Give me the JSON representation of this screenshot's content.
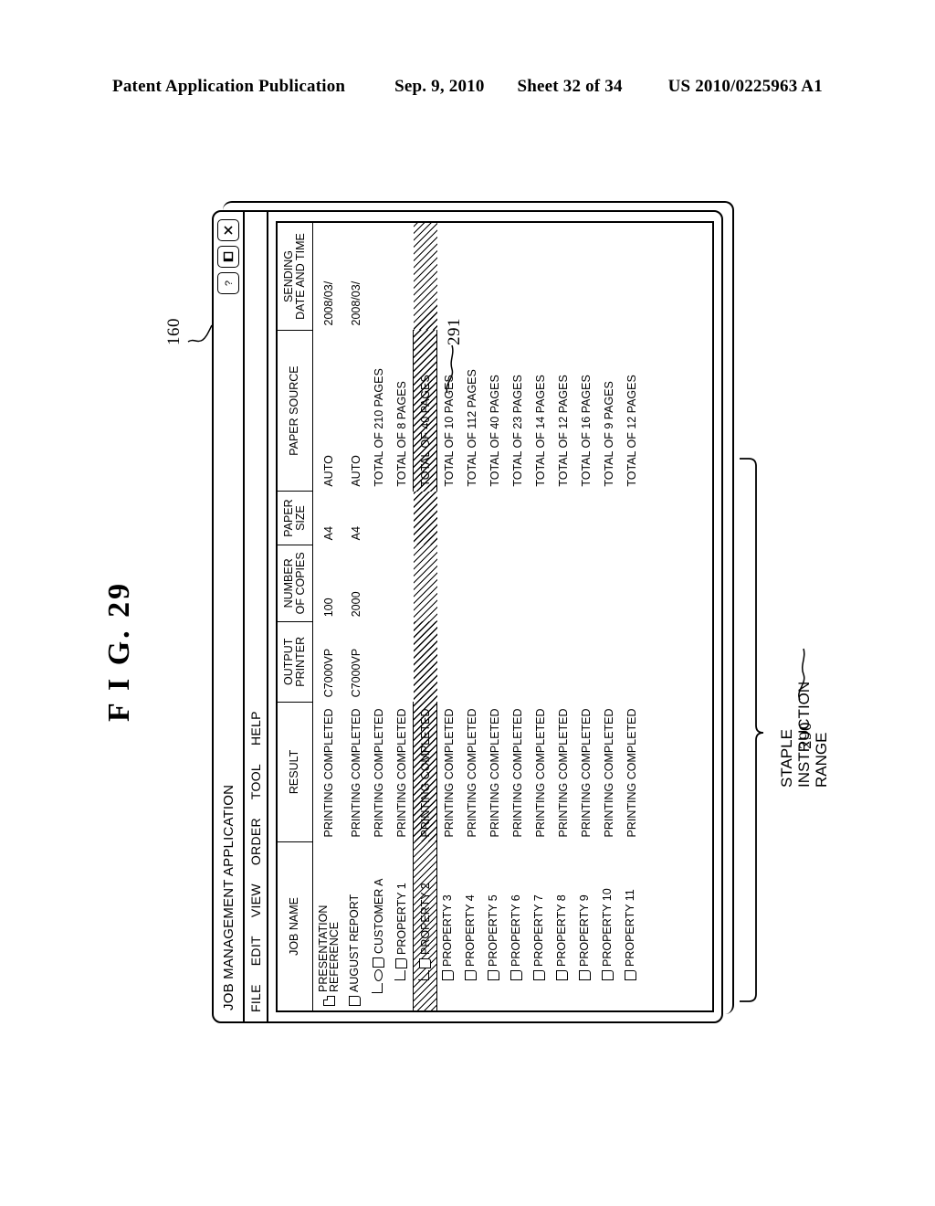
{
  "patent_header": {
    "publication": "Patent Application Publication",
    "date": "Sep. 9, 2010",
    "sheet": "Sheet 32 of 34",
    "number": "US 2010/0225963 A1"
  },
  "figure": {
    "caption": "F I G. 29",
    "callouts": {
      "window_ref": "160",
      "selected_row_ref": "291",
      "range_ref": "290",
      "range_label_line1": "STAPLE",
      "range_label_line2": "INSTRUCTION",
      "range_label_line3": "RANGE"
    }
  },
  "window": {
    "title": "JOB MANAGEMENT APPLICATION",
    "buttons": [
      {
        "name": "help-button",
        "glyph": "?"
      },
      {
        "name": "maximize-button",
        "glyph": "maximize"
      },
      {
        "name": "close-button",
        "glyph": "close"
      }
    ],
    "menu": [
      "FILE",
      "EDIT",
      "VIEW",
      "ORDER",
      "TOOL",
      "HELP"
    ]
  },
  "table": {
    "columns": [
      {
        "line1": "JOB NAME",
        "line2": ""
      },
      {
        "line1": "RESULT",
        "line2": ""
      },
      {
        "line1": "OUTPUT",
        "line2": "PRINTER"
      },
      {
        "line1": "NUMBER",
        "line2": "OF COPIES"
      },
      {
        "line1": "PAPER",
        "line2": "SIZE"
      },
      {
        "line1": "PAPER SOURCE",
        "line2": ""
      },
      {
        "line1": "SENDING",
        "line2": "DATE AND TIME"
      }
    ],
    "rows": [
      {
        "name_line1": "PRESENTATION",
        "name_line2": "REFERENCE",
        "indent": 1,
        "icon": "folded-doc",
        "elbow": false,
        "staple": false,
        "result": "PRINTING COMPLETED",
        "printer": "C7000VP",
        "copies": "100",
        "size": "A4",
        "source": "AUTO",
        "date": "2008/03/",
        "selected": false
      },
      {
        "name_line1": "AUGUST REPORT",
        "name_line2": "",
        "indent": 1,
        "icon": "doc",
        "elbow": false,
        "staple": false,
        "result": "PRINTING COMPLETED",
        "printer": "C7000VP",
        "copies": "2000",
        "size": "A4",
        "source": "AUTO",
        "date": "2008/03/",
        "selected": false
      },
      {
        "name_line1": "CUSTOMER A",
        "name_line2": "",
        "indent": 2,
        "icon": "doc",
        "elbow": true,
        "staple": true,
        "result": "PRINTING COMPLETED",
        "printer": "",
        "copies": "",
        "size": "",
        "source": "TOTAL OF 210 PAGES",
        "date": "",
        "selected": false
      },
      {
        "name_line1": "PROPERTY 1",
        "name_line2": "",
        "indent": 3,
        "icon": "doc",
        "elbow": true,
        "staple": false,
        "result": "PRINTING COMPLETED",
        "printer": "",
        "copies": "",
        "size": "",
        "source": "TOTAL OF 8 PAGES",
        "date": "",
        "selected": false
      },
      {
        "name_line1": "PROPERTY 2",
        "name_line2": "",
        "indent": 3,
        "icon": "doc",
        "elbow": true,
        "staple": false,
        "result": "PRINTING COMPLETED",
        "printer": "",
        "copies": "",
        "size": "",
        "source": "TOTAL OF 40 PAGES",
        "date": "",
        "selected": true
      },
      {
        "name_line1": "PROPERTY 3",
        "name_line2": "",
        "indent": 3,
        "icon": "doc",
        "elbow": false,
        "staple": false,
        "result": "PRINTING COMPLETED",
        "printer": "",
        "copies": "",
        "size": "",
        "source": "TOTAL OF 10 PAGES",
        "date": "",
        "selected": false
      },
      {
        "name_line1": "PROPERTY 4",
        "name_line2": "",
        "indent": 3,
        "icon": "doc",
        "elbow": false,
        "staple": false,
        "result": "PRINTING COMPLETED",
        "printer": "",
        "copies": "",
        "size": "",
        "source": "TOTAL OF 112 PAGES",
        "date": "",
        "selected": false
      },
      {
        "name_line1": "PROPERTY 5",
        "name_line2": "",
        "indent": 3,
        "icon": "doc",
        "elbow": false,
        "staple": false,
        "result": "PRINTING COMPLETED",
        "printer": "",
        "copies": "",
        "size": "",
        "source": "TOTAL OF 40 PAGES",
        "date": "",
        "selected": false
      },
      {
        "name_line1": "PROPERTY 6",
        "name_line2": "",
        "indent": 3,
        "icon": "doc",
        "elbow": false,
        "staple": false,
        "result": "PRINTING COMPLETED",
        "printer": "",
        "copies": "",
        "size": "",
        "source": "TOTAL OF 23 PAGES",
        "date": "",
        "selected": false
      },
      {
        "name_line1": "PROPERTY 7",
        "name_line2": "",
        "indent": 3,
        "icon": "doc",
        "elbow": false,
        "staple": false,
        "result": "PRINTING COMPLETED",
        "printer": "",
        "copies": "",
        "size": "",
        "source": "TOTAL OF 14 PAGES",
        "date": "",
        "selected": false
      },
      {
        "name_line1": "PROPERTY 8",
        "name_line2": "",
        "indent": 3,
        "icon": "doc",
        "elbow": false,
        "staple": false,
        "result": "PRINTING COMPLETED",
        "printer": "",
        "copies": "",
        "size": "",
        "source": "TOTAL OF 12 PAGES",
        "date": "",
        "selected": false
      },
      {
        "name_line1": "PROPERTY 9",
        "name_line2": "",
        "indent": 3,
        "icon": "doc",
        "elbow": false,
        "staple": false,
        "result": "PRINTING COMPLETED",
        "printer": "",
        "copies": "",
        "size": "",
        "source": "TOTAL OF 16 PAGES",
        "date": "",
        "selected": false
      },
      {
        "name_line1": "PROPERTY 10",
        "name_line2": "",
        "indent": 3,
        "icon": "doc",
        "elbow": false,
        "staple": false,
        "result": "PRINTING COMPLETED",
        "printer": "",
        "copies": "",
        "size": "",
        "source": "TOTAL OF 9 PAGES",
        "date": "",
        "selected": false
      },
      {
        "name_line1": "PROPERTY 11",
        "name_line2": "",
        "indent": 3,
        "icon": "doc",
        "elbow": false,
        "staple": false,
        "result": "PRINTING COMPLETED",
        "printer": "",
        "copies": "",
        "size": "",
        "source": "TOTAL OF 12 PAGES",
        "date": "",
        "selected": false
      }
    ]
  }
}
